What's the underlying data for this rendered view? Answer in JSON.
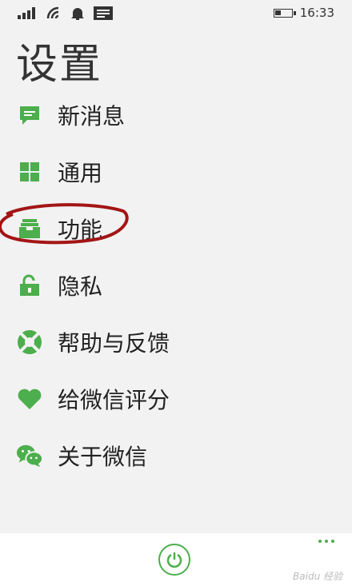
{
  "status_bar": {
    "time": "16:33",
    "icons": [
      "signal-icon",
      "wifi-icon",
      "bell-icon",
      "message-icon",
      "battery-icon"
    ]
  },
  "page": {
    "title": "设置"
  },
  "colors": {
    "accent": "#4cae4c",
    "highlight_ring": "#a31515",
    "background": "#f2f2f2"
  },
  "menu": {
    "items": [
      {
        "label": "新消息",
        "icon": "message-icon"
      },
      {
        "label": "通用",
        "icon": "grid-icon"
      },
      {
        "label": "功能",
        "icon": "inbox-icon"
      },
      {
        "label": "隐私",
        "icon": "lock-icon"
      },
      {
        "label": "帮助与反馈",
        "icon": "lifebuoy-icon"
      },
      {
        "label": "给微信评分",
        "icon": "heart-icon"
      },
      {
        "label": "关于微信",
        "icon": "wechat-icon"
      }
    ]
  },
  "bottom_bar": {
    "icons": [
      "power-icon",
      "more-icon"
    ]
  },
  "watermark": "Baidu 经验"
}
